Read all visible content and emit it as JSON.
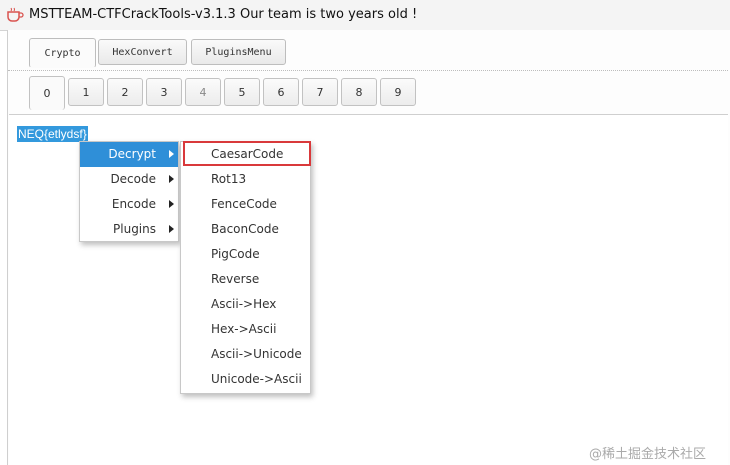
{
  "window": {
    "title": "MSTTEAM-CTFCrackTools-v3.1.3 Our team is two years old !",
    "icon": "coffee-cup-icon"
  },
  "top_tabs": [
    {
      "label": "Crypto",
      "active": true
    },
    {
      "label": "HexConvert",
      "active": false
    },
    {
      "label": "PluginsMenu",
      "active": false
    }
  ],
  "num_tabs": [
    "0",
    "1",
    "2",
    "3",
    "4",
    "5",
    "6",
    "7",
    "8",
    "9"
  ],
  "editor": {
    "selected_text": "NEQ{etlydsf}"
  },
  "context_menu": {
    "items": [
      "Decrypt",
      "Decode",
      "Encode",
      "Plugins"
    ],
    "highlighted": "Decrypt"
  },
  "submenu": {
    "items": [
      "CaesarCode",
      "Rot13",
      "FenceCode",
      "BaconCode",
      "PigCode",
      "Reverse",
      "Ascii->Hex",
      "Hex->Ascii",
      "Ascii->Unicode",
      "Unicode->Ascii"
    ],
    "boxed": "CaesarCode"
  },
  "watermark": "@稀土掘金技术社区",
  "colors": {
    "selection": "#3399dd",
    "menu_highlight": "#2f8fd8",
    "annotation_box": "#d9393b"
  }
}
